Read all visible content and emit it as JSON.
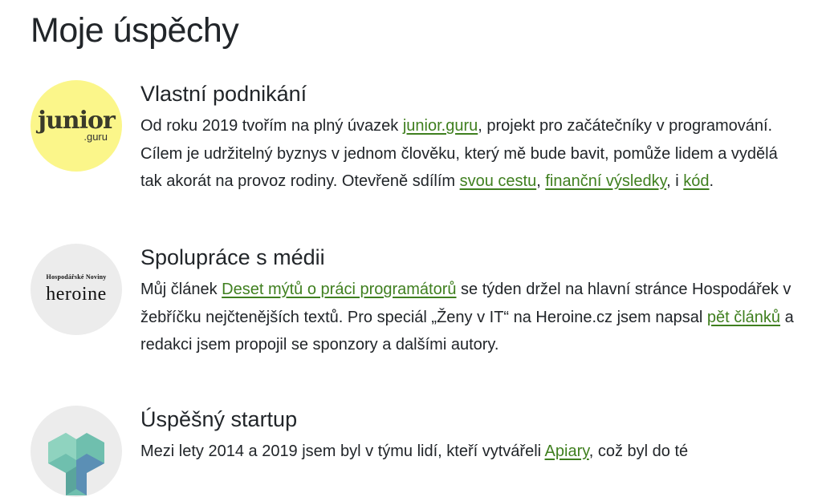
{
  "page_title": "Moje úspěchy",
  "items": [
    {
      "logo_text": [
        "junior",
        ".guru"
      ],
      "heading": "Vlastní podnikání",
      "segments": [
        {
          "t": "Od roku 2019 tvořím na plný úvazek "
        },
        {
          "link": "junior.guru"
        },
        {
          "t": ", projekt pro začátečníky v programování. Cílem je udržitelný byznys v jednom člověku, který mě bude bavit, pomůže lidem a vydělá tak akorát na provoz rodiny. Otevřeně sdílím "
        },
        {
          "link": "svou cestu"
        },
        {
          "t": ", "
        },
        {
          "link": "finanční výsledky"
        },
        {
          "t": ", i "
        },
        {
          "link": "kód"
        },
        {
          "t": "."
        }
      ]
    },
    {
      "logo_text": [
        "Hospodářské Noviny",
        "heroine"
      ],
      "heading": "Spolupráce s médii",
      "segments": [
        {
          "t": "Můj článek "
        },
        {
          "link": "Deset mýtů o práci programátorů"
        },
        {
          "t": " se týden držel na hlavní stránce Hospodářek v žebříčku nejčtenějších textů. Pro speciál „Ženy v IT“ na Heroine.cz jsem napsal "
        },
        {
          "link": "pět článků"
        },
        {
          "t": " a redakci jsem propojil se sponzory a dalšími autory."
        }
      ]
    },
    {
      "logo_text": [],
      "heading": "Úspěšný startup",
      "segments": [
        {
          "t": "Mezi lety 2014 a 2019 jsem byl v týmu lidí, kteří vytvářeli "
        },
        {
          "link": "Apiary"
        },
        {
          "t": ", což byl do té"
        }
      ]
    }
  ],
  "colors": {
    "link": "#3f7f1f",
    "text": "#212529",
    "junior_bg": "#fbf68a",
    "logo_bg": "#ececec"
  }
}
